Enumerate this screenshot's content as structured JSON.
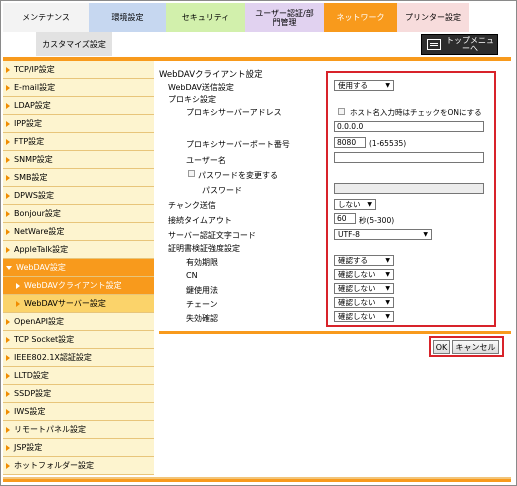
{
  "tabs": {
    "maintenance": "メンテナンス",
    "environment": "環境設定",
    "security": "セキュリティ",
    "user_auth": "ユーザー認証/部門管理",
    "network": "ネットワーク",
    "printer": "プリンター設定"
  },
  "subtab": "カスタマイズ設定",
  "top_menu": "トップメニューへ",
  "sidebar": {
    "items": [
      "TCP/IP設定",
      "E-mail設定",
      "LDAP設定",
      "IPP設定",
      "FTP設定",
      "SNMP設定",
      "SMB設定",
      "DPWS設定",
      "Bonjour設定",
      "NetWare設定",
      "AppleTalk設定",
      "WebDAV設定",
      "WebDAVクライアント設定",
      "WebDAVサーバー設定",
      "OpenAPI設定",
      "TCP Socket設定",
      "IEEE802.1X認証設定",
      "LLTD設定",
      "SSDP設定",
      "IWS設定",
      "リモートパネル設定",
      "JSP設定",
      "ホットフォルダー設定"
    ]
  },
  "main": {
    "title": "WebDAVクライアント設定",
    "webdav_send_label": "WebDAV送信設定",
    "webdav_send_value": "使用する",
    "proxy_label": "プロキシ設定",
    "proxy_addr_label": "プロキシサーバーアドレス",
    "hostname_check_label": "ホスト名入力時はチェックをONにする",
    "proxy_addr_value": "0.0.0.0",
    "proxy_port_label": "プロキシサーバーポート番号",
    "proxy_port_value": "8080",
    "proxy_port_range": "(1-65535)",
    "username_label": "ユーザー名",
    "username_value": "",
    "change_password_label": "パスワードを変更する",
    "password_label": "パスワード",
    "chunk_label": "チャンク送信",
    "chunk_value": "しない",
    "timeout_label": "接続タイムアウト",
    "timeout_value": "60",
    "timeout_unit": "秒(5-300)",
    "charset_label": "サーバー認証文字コード",
    "charset_value": "UTF-8",
    "cert_label": "証明書検証強度設定",
    "validity_label": "有効期限",
    "validity_value": "確認する",
    "cn_label": "CN",
    "cn_value": "確認しない",
    "key_usage_label": "鍵使用法",
    "key_usage_value": "確認しない",
    "chain_label": "チェーン",
    "chain_value": "確認しない",
    "revocation_label": "失効確認",
    "revocation_value": "確認しない"
  },
  "buttons": {
    "ok": "OK",
    "cancel": "キャンセル"
  },
  "colors": {
    "accent": "#f89a1c",
    "highlight": "#d8232a"
  }
}
